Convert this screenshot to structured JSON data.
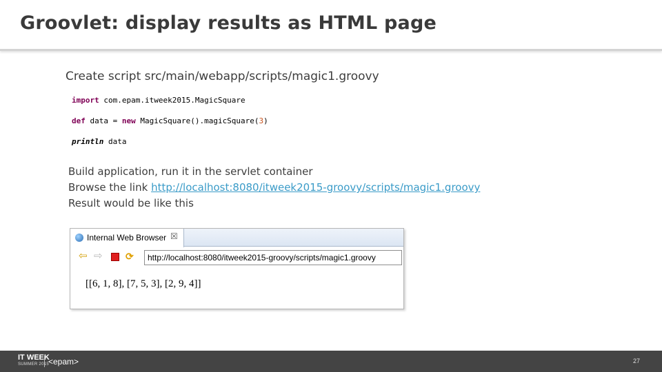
{
  "slide": {
    "title": "Groovlet: display results as HTML page",
    "create_line": "Create script src/main/webapp/scripts/magic1.groovy",
    "build_line": "Build application, run it in the servlet container",
    "browse_prefix": "Browse the link ",
    "browse_link": "http://localhost:8080/itweek2015-groovy/scripts/magic1.groovy",
    "result_line": "Result would be like this",
    "page_number": "27"
  },
  "code": {
    "line1_kw": "import",
    "line1_rest": " com.epam.itweek2015.MagicSquare",
    "line2_kw1": "def",
    "line2_mid1": " data = ",
    "line2_kw2": "new",
    "line2_mid2": " MagicSquare().magicSquare(",
    "line2_num": "3",
    "line2_end": ")",
    "line3_kw": "println",
    "line3_rest": " data"
  },
  "browser": {
    "tab_label": "Internal Web Browser",
    "tab_close": "☒",
    "address": "http://localhost:8080/itweek2015-groovy/scripts/magic1.groovy",
    "content": "[[6, 1, 8], [7, 5, 3], [2, 9, 4]]",
    "icons": [
      "globe-icon",
      "back-arrow-icon",
      "forward-arrow-icon",
      "stop-icon",
      "refresh-icon"
    ]
  },
  "footer": {
    "brand": "IT WEEK",
    "season": "SUMMER 2015",
    "company": "<epam>"
  }
}
